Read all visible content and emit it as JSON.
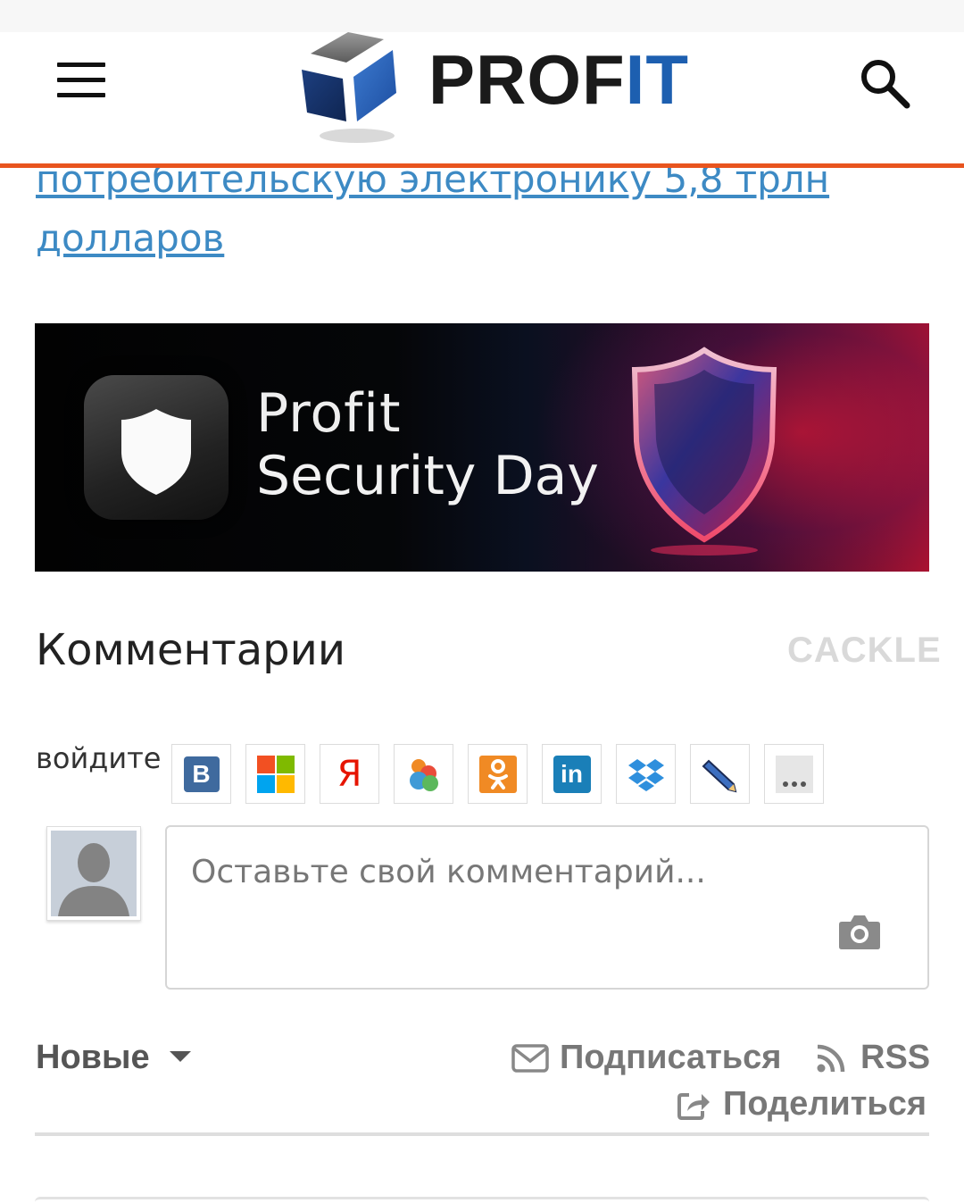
{
  "header": {
    "logo_pro": "PROF",
    "logo_it": "IT",
    "accent_color": "#e8541e",
    "menu_icon": "hamburger-menu-icon",
    "search_icon": "search-icon"
  },
  "article": {
    "link_text": "потребительскую электронику 5,8 трлн долларов"
  },
  "banner": {
    "line1": "Profit",
    "line2": "Security Day"
  },
  "comments": {
    "title": "Комментарии",
    "brand": "CACKLE",
    "login_label": "войдите",
    "providers": [
      {
        "name": "vk",
        "icon": "vk-icon"
      },
      {
        "name": "microsoft",
        "icon": "microsoft-icon"
      },
      {
        "name": "yandex",
        "icon": "yandex-icon"
      },
      {
        "name": "mail",
        "icon": "mail-agent-icon"
      },
      {
        "name": "odnoklassniki",
        "icon": "odnoklassniki-icon"
      },
      {
        "name": "linkedin",
        "icon": "linkedin-icon"
      },
      {
        "name": "dropbox",
        "icon": "dropbox-icon"
      },
      {
        "name": "livejournal",
        "icon": "pencil-icon"
      },
      {
        "name": "more",
        "icon": "more-icon"
      }
    ],
    "input_placeholder": "Оставьте свой комментарий...",
    "sort_label": "Новые",
    "subscribe_label": "Подписаться",
    "rss_label": "RSS",
    "share_label": "Поделиться"
  }
}
